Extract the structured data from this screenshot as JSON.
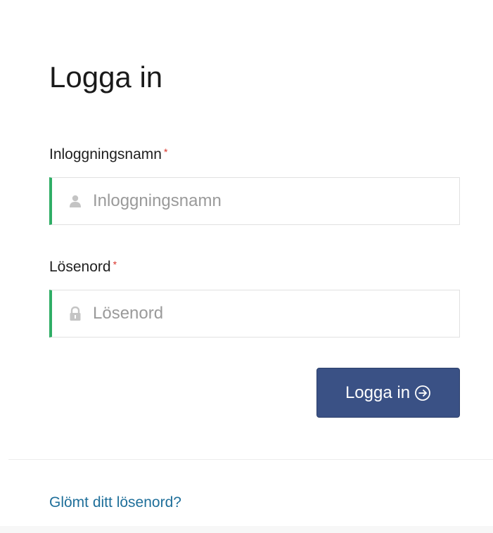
{
  "login": {
    "title": "Logga in",
    "username": {
      "label": "Inloggningsnamn",
      "required_marker": "*",
      "placeholder": "Inloggningsnamn",
      "icon": "user-icon"
    },
    "password": {
      "label": "Lösenord",
      "required_marker": "*",
      "placeholder": "Lösenord",
      "icon": "lock-icon"
    },
    "submit_label": "Logga in",
    "submit_icon": "arrow-circle-right-icon",
    "forgot_link": "Glömt ditt lösenord?"
  },
  "colors": {
    "accent": "#3a5185",
    "valid_border": "#2fae66",
    "required": "#d9342b",
    "link": "#1f6f9a"
  }
}
